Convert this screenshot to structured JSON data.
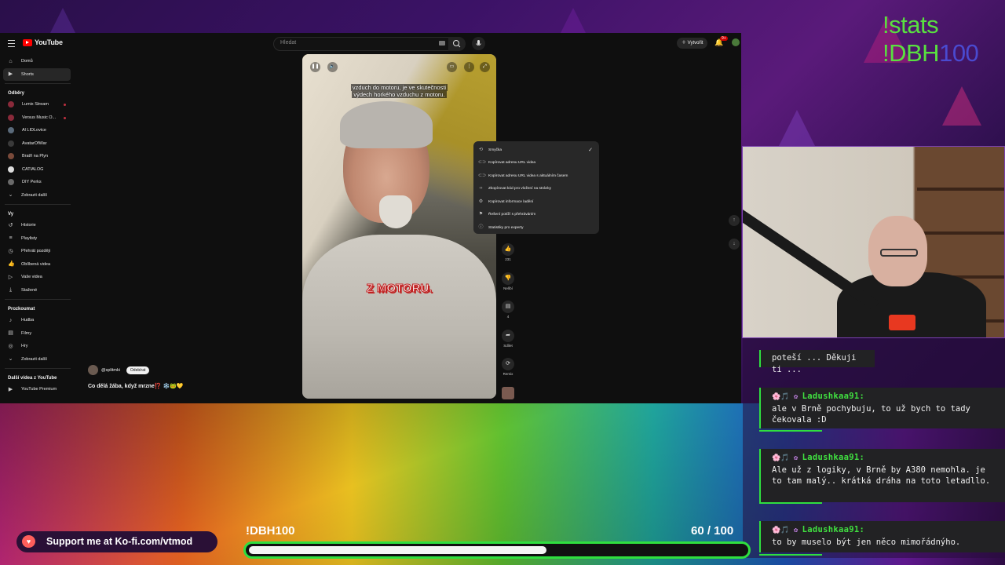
{
  "youtube": {
    "logo_text": "YouTube",
    "search_placeholder": "Hledat",
    "create_label": "Vytvořit",
    "notif_count": "9+",
    "sidebar": {
      "main": [
        {
          "label": "Domů",
          "icon": "home-icon"
        },
        {
          "label": "Shorts",
          "icon": "shorts-icon",
          "active": true
        }
      ],
      "subs_heading": "Odběry",
      "subs": [
        {
          "label": "Lumix Stream",
          "color": "#8a2a3a",
          "dot": true
        },
        {
          "label": "Versus Music O...",
          "color": "#8a2a3a",
          "dot": true
        },
        {
          "label": "Al LIDLovice",
          "color": "#5a6a7a"
        },
        {
          "label": "AvatarOfWar",
          "color": "#3a3a3a"
        },
        {
          "label": "Bratři na Plyn",
          "color": "#7a4a3a"
        },
        {
          "label": "CATIALOG",
          "color": "#ddd"
        },
        {
          "label": "DIY Perks",
          "color": "#6a6a6a"
        }
      ],
      "subs_more": "Zobrazit další",
      "you_heading": "Vy",
      "you": [
        {
          "label": "Historie",
          "icon": "history-icon"
        },
        {
          "label": "Playlisty",
          "icon": "playlist-icon"
        },
        {
          "label": "Přehrát později",
          "icon": "watch-later-icon"
        },
        {
          "label": "Oblíbená videa",
          "icon": "like-icon"
        },
        {
          "label": "Vaše videa",
          "icon": "video-icon"
        },
        {
          "label": "Stažené",
          "icon": "download-icon"
        }
      ],
      "explore_heading": "Prozkoumat",
      "explore": [
        {
          "label": "Hudba",
          "icon": "music-icon"
        },
        {
          "label": "Filmy",
          "icon": "film-icon"
        },
        {
          "label": "Hry",
          "icon": "game-icon"
        }
      ],
      "explore_more": "Zobrazit další",
      "more_heading": "Další videa z YouTube",
      "more": [
        {
          "label": "YouTube Premium",
          "icon": "youtube-premium-icon"
        }
      ]
    },
    "short": {
      "channel": "@splitmki",
      "subscribe_label": "Odebírat",
      "title": "Co dělá žába, když mrzne⁉️ ❄️🐸💛",
      "caption_top": [
        "vzduch do motoru, je ve skutečnosti",
        "výdech horkého vzduchu z motoru."
      ],
      "caption_big": "Z MOTORU."
    },
    "actions": [
      {
        "label": "231",
        "icon": "thumbs-up-icon"
      },
      {
        "label": "Nelíbí",
        "icon": "thumbs-down-icon"
      },
      {
        "label": "4",
        "icon": "comment-icon"
      },
      {
        "label": "Sdílet",
        "icon": "share-icon"
      },
      {
        "label": "Remix",
        "icon": "remix-icon"
      }
    ],
    "menu": [
      {
        "label": "Smyčka",
        "icon": "loop-icon",
        "checked": true
      },
      {
        "label": "Kopírovat adresu URL videa",
        "icon": "link-icon"
      },
      {
        "label": "Kopírovat adresu URL videa s aktuálním časem",
        "icon": "link-icon"
      },
      {
        "label": "Zkopírovat kód pro vložení na stránky",
        "icon": "embed-icon"
      },
      {
        "label": "Kopírovat informace ladění",
        "icon": "debug-icon"
      },
      {
        "label": "Řešení potíží s přehráváním",
        "icon": "troubleshoot-icon"
      },
      {
        "label": "Statistiky pro experty",
        "icon": "info-icon"
      }
    ]
  },
  "overlay": {
    "stats_line1": "!stats",
    "stats_line2a": "!DBH",
    "stats_line2b": "100",
    "chat": [
      {
        "user": "",
        "text": "poteší ... Děkuji ti ..."
      },
      {
        "user": "Ladushkaa91:",
        "text": "ale v Brně pochybuju, to už bych to tady čekovala :D"
      },
      {
        "user": "Ladushkaa91:",
        "text": "Ale už z logiky, v Brně by A380 nemohla. je to tam malý.. krátká dráha na toto letadllo."
      },
      {
        "user": "Ladushkaa91:",
        "text": "to by muselo být jen něco mimořádnýho."
      }
    ],
    "kofi_text": "Support me at Ko-fi.com/vtmod",
    "goal_name": "!DBH100",
    "goal_current": 60,
    "goal_total": 100,
    "goal_text": "60  / 100"
  }
}
